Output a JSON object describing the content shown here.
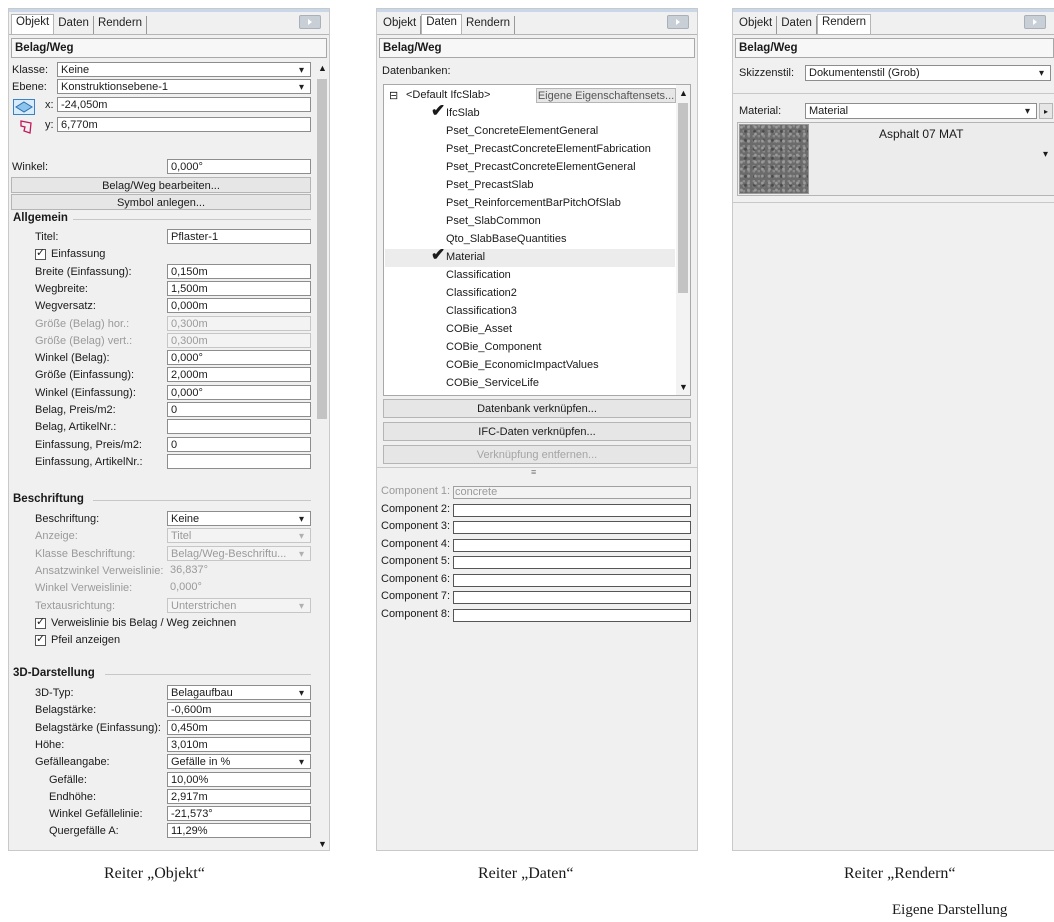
{
  "tabs": [
    "Objekt",
    "Daten",
    "Rendern"
  ],
  "p1": {
    "title": "Belag/Weg",
    "klasse_lbl": "Klasse:",
    "klasse_val": "Keine",
    "ebene_lbl": "Ebene:",
    "ebene_val": "Konstruktionsebene-1",
    "x_lbl": "x:",
    "x_val": "-24,050m",
    "y_lbl": "y:",
    "y_val": "6,770m",
    "winkel_lbl": "Winkel:",
    "winkel_val": "0,000°",
    "btn_edit": "Belag/Weg bearbeiten...",
    "btn_symbol": "Symbol anlegen...",
    "sect_allgemein": "Allgemein",
    "sect_beschriftung": "Beschriftung",
    "sect_3d": "3D-Darstellung",
    "allgemein": [
      {
        "label": "Titel:",
        "value": "Pflaster-1",
        "disabled": false
      },
      {
        "label": "Einfassung",
        "check": true
      },
      {
        "label": "Breite (Einfassung):",
        "value": "0,150m",
        "disabled": false
      },
      {
        "label": "Wegbreite:",
        "value": "1,500m",
        "disabled": false
      },
      {
        "label": "Wegversatz:",
        "value": "0,000m",
        "disabled": false
      },
      {
        "label": "Größe (Belag) hor.:",
        "value": "0,300m",
        "disabled": true
      },
      {
        "label": "Größe (Belag) vert.:",
        "value": "0,300m",
        "disabled": true
      },
      {
        "label": "Winkel (Belag):",
        "value": "0,000°",
        "disabled": false
      },
      {
        "label": "Größe (Einfassung):",
        "value": "2,000m",
        "disabled": false
      },
      {
        "label": "Winkel (Einfassung):",
        "value": "0,000°",
        "disabled": false
      },
      {
        "label": "Belag, Preis/m2:",
        "value": "0",
        "disabled": false
      },
      {
        "label": "Belag, ArtikelNr.:",
        "value": "",
        "disabled": false
      },
      {
        "label": "Einfassung, Preis/m2:",
        "value": "0",
        "disabled": false
      },
      {
        "label": "Einfassung, ArtikelNr.:",
        "value": "",
        "disabled": false
      }
    ],
    "beschriftung": [
      {
        "label": "Beschriftung:",
        "value": "Keine",
        "disabled": false,
        "dropdown": true
      },
      {
        "label": "Anzeige:",
        "value": "Titel",
        "disabled": true,
        "dropdown": true
      },
      {
        "label": "Klasse Beschriftung:",
        "value": "Belag/Weg-Beschriftu...",
        "disabled": true,
        "dropdown": true
      },
      {
        "label": "Ansatzwinkel Verweislinie:",
        "value": "36,837°",
        "disabled": true,
        "plain": true
      },
      {
        "label": "Winkel Verweislinie:",
        "value": "0,000°",
        "disabled": true,
        "plain": true
      },
      {
        "label": "Textausrichtung:",
        "value": "Unterstrichen",
        "disabled": true,
        "dropdown": true
      },
      {
        "label": "Verweislinie bis Belag / Weg zeichnen",
        "check": true
      },
      {
        "label": "Pfeil anzeigen",
        "check": true
      }
    ],
    "darstellung": [
      {
        "label": "3D-Typ:",
        "value": "Belagaufbau",
        "dropdown": true,
        "indent": 0
      },
      {
        "label": "Belagstärke:",
        "value": "-0,600m",
        "indent": 0
      },
      {
        "label": "Belagstärke (Einfassung):",
        "value": "0,450m",
        "indent": 0
      },
      {
        "label": "Höhe:",
        "value": "3,010m",
        "indent": 0
      },
      {
        "label": "Gefälleangabe:",
        "value": "Gefälle in %",
        "dropdown": true,
        "indent": 0
      },
      {
        "label": "Gefälle:",
        "value": "10,00%",
        "indent": 1
      },
      {
        "label": "Endhöhe:",
        "value": "2,917m",
        "indent": 1
      },
      {
        "label": "Winkel Gefällelinie:",
        "value": "-21,573°",
        "indent": 1
      },
      {
        "label": "Quergefälle A:",
        "value": "11,29%",
        "indent": 1
      }
    ]
  },
  "p2": {
    "title": "Belag/Weg",
    "datenbanken_lbl": "Datenbanken:",
    "root_label": "<Default IfcSlab>",
    "eigene_btn": "Eigene Eigenschaftensets...",
    "items": [
      {
        "label": "IfcSlab",
        "checked": true
      },
      {
        "label": "Pset_ConcreteElementGeneral",
        "checked": false
      },
      {
        "label": "Pset_PrecastConcreteElementFabrication",
        "checked": false
      },
      {
        "label": "Pset_PrecastConcreteElementGeneral",
        "checked": false
      },
      {
        "label": "Pset_PrecastSlab",
        "checked": false
      },
      {
        "label": "Pset_ReinforcementBarPitchOfSlab",
        "checked": false
      },
      {
        "label": "Pset_SlabCommon",
        "checked": false
      },
      {
        "label": "Qto_SlabBaseQuantities",
        "checked": false
      },
      {
        "label": "Material",
        "checked": true
      },
      {
        "label": "Classification",
        "checked": false
      },
      {
        "label": "Classification2",
        "checked": false
      },
      {
        "label": "Classification3",
        "checked": false
      },
      {
        "label": "COBie_Asset",
        "checked": false
      },
      {
        "label": "COBie_Component",
        "checked": false
      },
      {
        "label": "COBie_EconomicImpactValues",
        "checked": false
      },
      {
        "label": "COBie_ServiceLife",
        "checked": false
      }
    ],
    "btn_db": "Datenbank verknüpfen...",
    "btn_ifc": "IFC-Daten verknüpfen...",
    "btn_remove": "Verknüpfung entfernen...",
    "components": [
      {
        "label": "Component 1:",
        "value": "concrete",
        "disabled": true
      },
      {
        "label": "Component 2:",
        "value": "",
        "disabled": false
      },
      {
        "label": "Component 3:",
        "value": "",
        "disabled": false
      },
      {
        "label": "Component 4:",
        "value": "",
        "disabled": false
      },
      {
        "label": "Component 5:",
        "value": "",
        "disabled": false
      },
      {
        "label": "Component 6:",
        "value": "",
        "disabled": false
      },
      {
        "label": "Component 7:",
        "value": "",
        "disabled": false
      },
      {
        "label": "Component 8:",
        "value": "",
        "disabled": false
      }
    ]
  },
  "p3": {
    "title": "Belag/Weg",
    "skizzen_lbl": "Skizzenstil:",
    "skizzen_val": "Dokumentenstil (Grob)",
    "material_lbl": "Material:",
    "material_val": "Material",
    "swatch_name": "Asphalt 07 MAT"
  },
  "captions": [
    "Reiter „Objekt“",
    "Reiter „Daten“",
    "Reiter „Rendern“"
  ],
  "footnote": "Eigene Darstellung"
}
